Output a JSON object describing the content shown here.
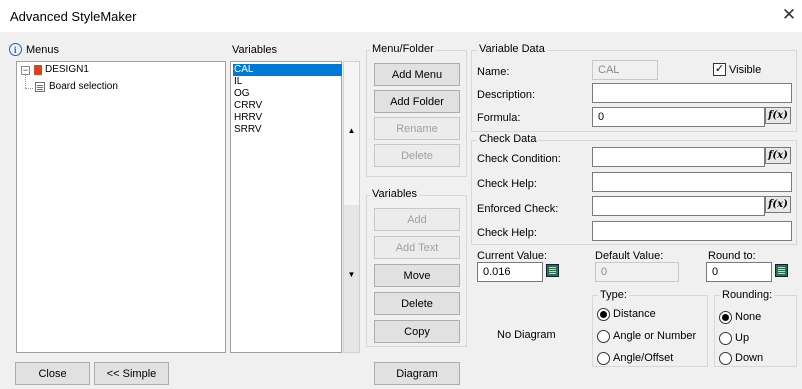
{
  "window": {
    "title": "Advanced StyleMaker",
    "close_glyph": "✕"
  },
  "menus_panel": {
    "label": "Menus",
    "tree_root": "DESIGN1",
    "tree_child": "Board selection",
    "expander": "−"
  },
  "variables_panel": {
    "label": "Variables",
    "items": [
      "CAL",
      "IL",
      "OG",
      "CRRV",
      "HRRV",
      "SRRV"
    ],
    "selected_index": 0,
    "scroll_up": "▲",
    "scroll_down": "▼"
  },
  "menu_folder_group": {
    "label": "Menu/Folder",
    "add_menu": "Add Menu",
    "add_folder": "Add Folder",
    "rename": "Rename",
    "delete": "Delete"
  },
  "variables_group": {
    "label": "Variables",
    "add": "Add",
    "add_text": "Add Text",
    "move": "Move",
    "delete": "Delete",
    "copy": "Copy"
  },
  "variable_data": {
    "label": "Variable Data",
    "name_label": "Name:",
    "name_value": "CAL",
    "visible_label": "Visible",
    "visible_checked": true,
    "check_mark": "✓",
    "description_label": "Description:",
    "description_value": "",
    "formula_label": "Formula:",
    "formula_value": "0",
    "fx_label": "f(x)"
  },
  "check_data": {
    "label": "Check Data",
    "check_condition_label": "Check Condition:",
    "check_condition_value": "",
    "check_help_label": "Check Help:",
    "check_help_value": "",
    "enforced_check_label": "Enforced Check:",
    "enforced_check_value": "",
    "check_help2_label": "Check Help:",
    "check_help2_value": ""
  },
  "values": {
    "current_label": "Current Value:",
    "current_value": "0.016",
    "default_label": "Default Value:",
    "default_value": "0",
    "round_label": "Round to:",
    "round_value": "0"
  },
  "type_group": {
    "label": "Type:",
    "options": [
      "Distance",
      "Angle or Number",
      "Angle/Offset"
    ],
    "selected": "Distance"
  },
  "rounding_group": {
    "label": "Rounding:",
    "options": [
      "None",
      "Up",
      "Down"
    ],
    "selected": "None"
  },
  "diagram": {
    "no_diagram": "No Diagram",
    "button": "Diagram"
  },
  "footer": {
    "close": "Close",
    "simple": "<< Simple"
  },
  "colors": {
    "selection": "#0078d7",
    "info_icon": "#2b5fb4",
    "design_icon": "#d9421c"
  }
}
